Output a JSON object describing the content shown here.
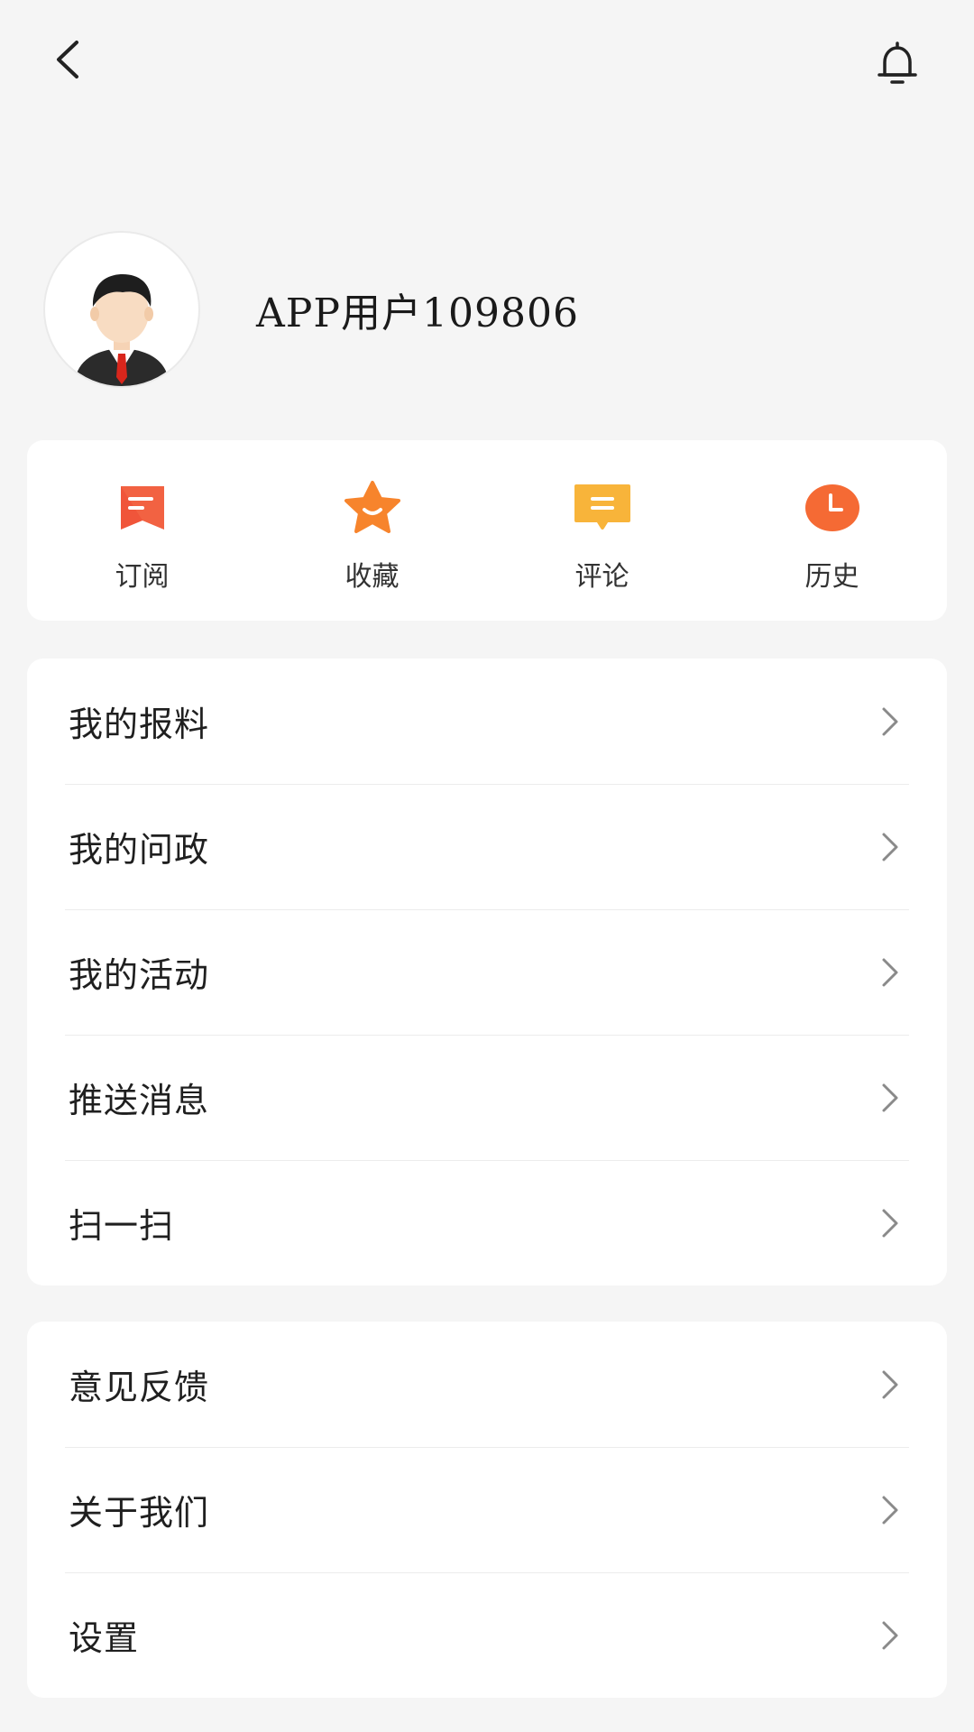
{
  "header": {
    "back_icon": "chevron-left-icon",
    "notification_icon": "bell-icon"
  },
  "profile": {
    "username": "APP用户109806",
    "avatar_icon": "user-avatar-icon"
  },
  "quick_actions": [
    {
      "label": "订阅",
      "icon": "subscribe-icon",
      "color": "#f0553a"
    },
    {
      "label": "收藏",
      "icon": "star-icon",
      "color": "#f7842c"
    },
    {
      "label": "评论",
      "icon": "comment-icon",
      "color": "#f8b43a"
    },
    {
      "label": "历史",
      "icon": "clock-icon",
      "color": "#f56a34"
    }
  ],
  "menu_group_1": [
    {
      "label": "我的报料"
    },
    {
      "label": "我的问政"
    },
    {
      "label": "我的活动"
    },
    {
      "label": "推送消息"
    },
    {
      "label": "扫一扫"
    }
  ],
  "menu_group_2": [
    {
      "label": "意见反馈"
    },
    {
      "label": "关于我们"
    },
    {
      "label": "设置"
    }
  ],
  "colors": {
    "background": "#f5f5f5",
    "card": "#ffffff",
    "text": "#1f1f1f",
    "chevron": "#8a8a8a"
  }
}
